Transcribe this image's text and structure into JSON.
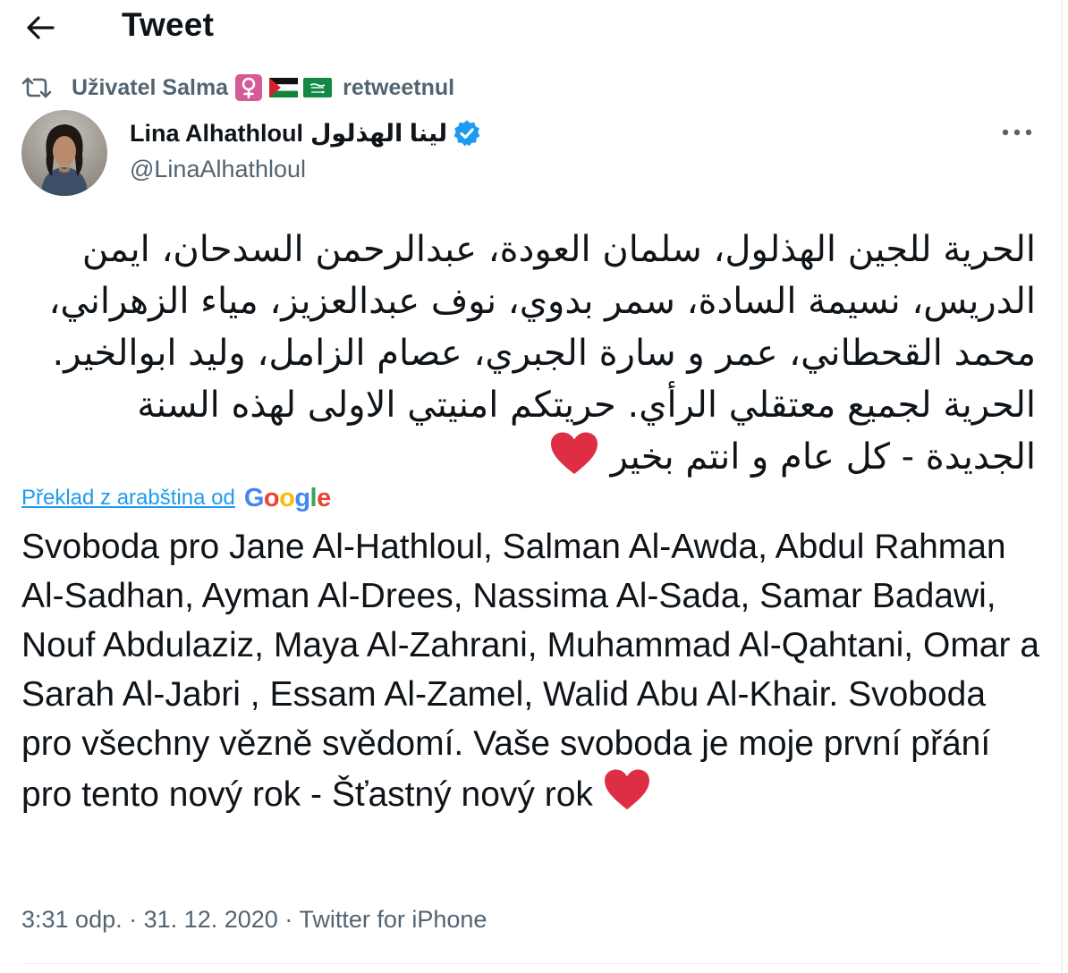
{
  "header": {
    "title": "Tweet",
    "back_icon": "arrow-left-icon"
  },
  "retweet_context": {
    "icon": "retweet-icon",
    "label": "Uživatel Salma",
    "emoji": [
      "female-sign-emoji",
      "palestine-flag-emoji",
      "saudi-flag-emoji"
    ],
    "suffix": "retweetnul"
  },
  "author": {
    "name": "Lina Alhathloul",
    "name_arabic": "لينا الهذلول",
    "verified": true,
    "handle": "@LinaAlhathloul"
  },
  "tweet": {
    "text_ar": "الحرية للجين الهذلول، سلمان العودة، عبدالرحمن السدحان، ايمن الدريس، نسيمة السادة، سمر بدوي، نوف عبدالعزيز، مياء الزهراني، محمد القحطاني، عمر و سارة الجبري، عصام الزامل، وليد ابوالخير. الحرية لجميع معتقلي الرأي. حريتكم امنيتي الاولى لهذه السنة الجديدة - كل عام و انتم بخير",
    "translate_link": "Překlad z arabština od",
    "translate_provider": "Google",
    "text_cs": "Svoboda pro Jane Al-Hathloul, Salman Al-Awda, Abdul Rahman Al-Sadhan, Ayman Al-Drees, Nassima Al-Sada, Samar Badawi, Nouf Abdulaziz, Maya Al-Zahrani, Muhammad Al-Qahtani, Omar a Sarah Al-Jabri , Essam Al-Zamel, Walid Abu Al-Khair. Svoboda pro všechny vězně svědomí. Vaše svoboda je moje první přání pro tento nový rok - Šťastný nový rok",
    "emoji_end": "red-heart-emoji"
  },
  "meta": {
    "time": "3:31 odp.",
    "date": "31. 12. 2020",
    "separator": "·",
    "source": "Twitter for iPhone"
  },
  "colors": {
    "text": "#0f1419",
    "secondary": "#536471",
    "link": "#1d9bf0",
    "heart": "#dd2e44",
    "divider": "#eff3f4"
  }
}
